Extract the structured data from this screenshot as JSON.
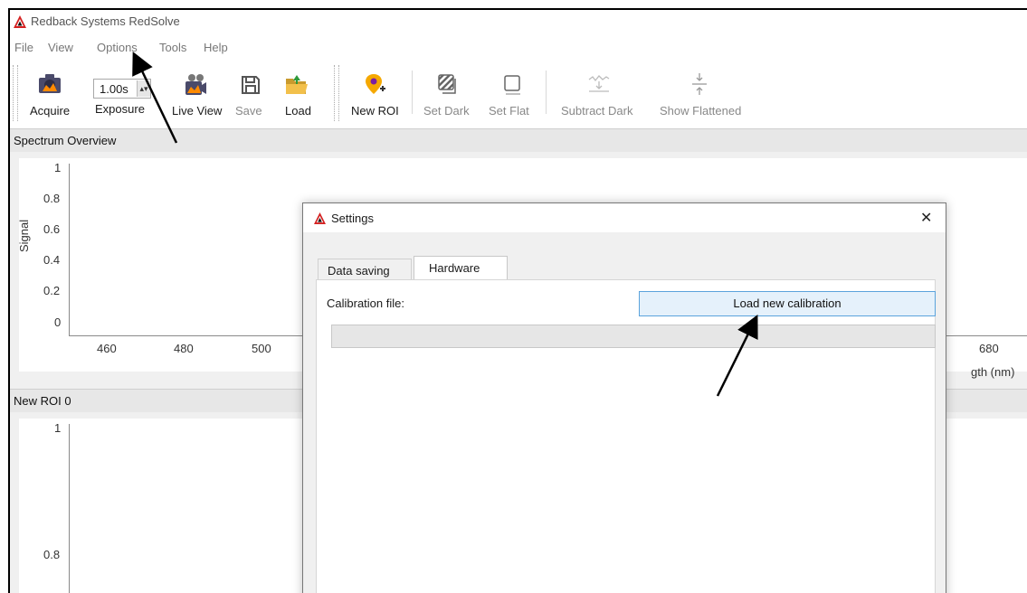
{
  "window": {
    "title": "Redback Systems RedSolve"
  },
  "menu": [
    "File",
    "View",
    "Options",
    "Tools",
    "Help"
  ],
  "toolbar": {
    "acquire": "Acquire",
    "exposure_value": "1.00s",
    "exposure": "Exposure",
    "live_view": "Live View",
    "save": "Save",
    "load": "Load",
    "new_roi": "New ROI",
    "set_dark": "Set Dark",
    "set_flat": "Set Flat",
    "subtract_dark": "Subtract Dark",
    "show_flattened": "Show Flattened"
  },
  "spectrum_panel": {
    "title": "Spectrum Overview",
    "y_axis_label": "Signal",
    "x_axis_label_visible": "gth (nm)",
    "y_ticks": [
      "1",
      "0.8",
      "0.6",
      "0.4",
      "0.2",
      "0"
    ],
    "x_ticks_left": [
      "460",
      "480",
      "500"
    ],
    "x_ticks_right": [
      "680"
    ]
  },
  "roi_panel": {
    "title": "New ROI 0",
    "y_ticks": [
      "1",
      "0.8"
    ]
  },
  "dialog": {
    "title": "Settings",
    "close": "✕",
    "tabs": [
      "Data saving",
      "Hardware"
    ],
    "active_tab": "Hardware",
    "calibration_label": "Calibration file:",
    "load_button": "Load new calibration",
    "progress": 0
  },
  "colors": {
    "accent_button_bg": "#e5f1fb",
    "accent_button_border": "#5ba3dc",
    "panel_header": "#e7e7e7",
    "logo_red": "#d42020"
  }
}
